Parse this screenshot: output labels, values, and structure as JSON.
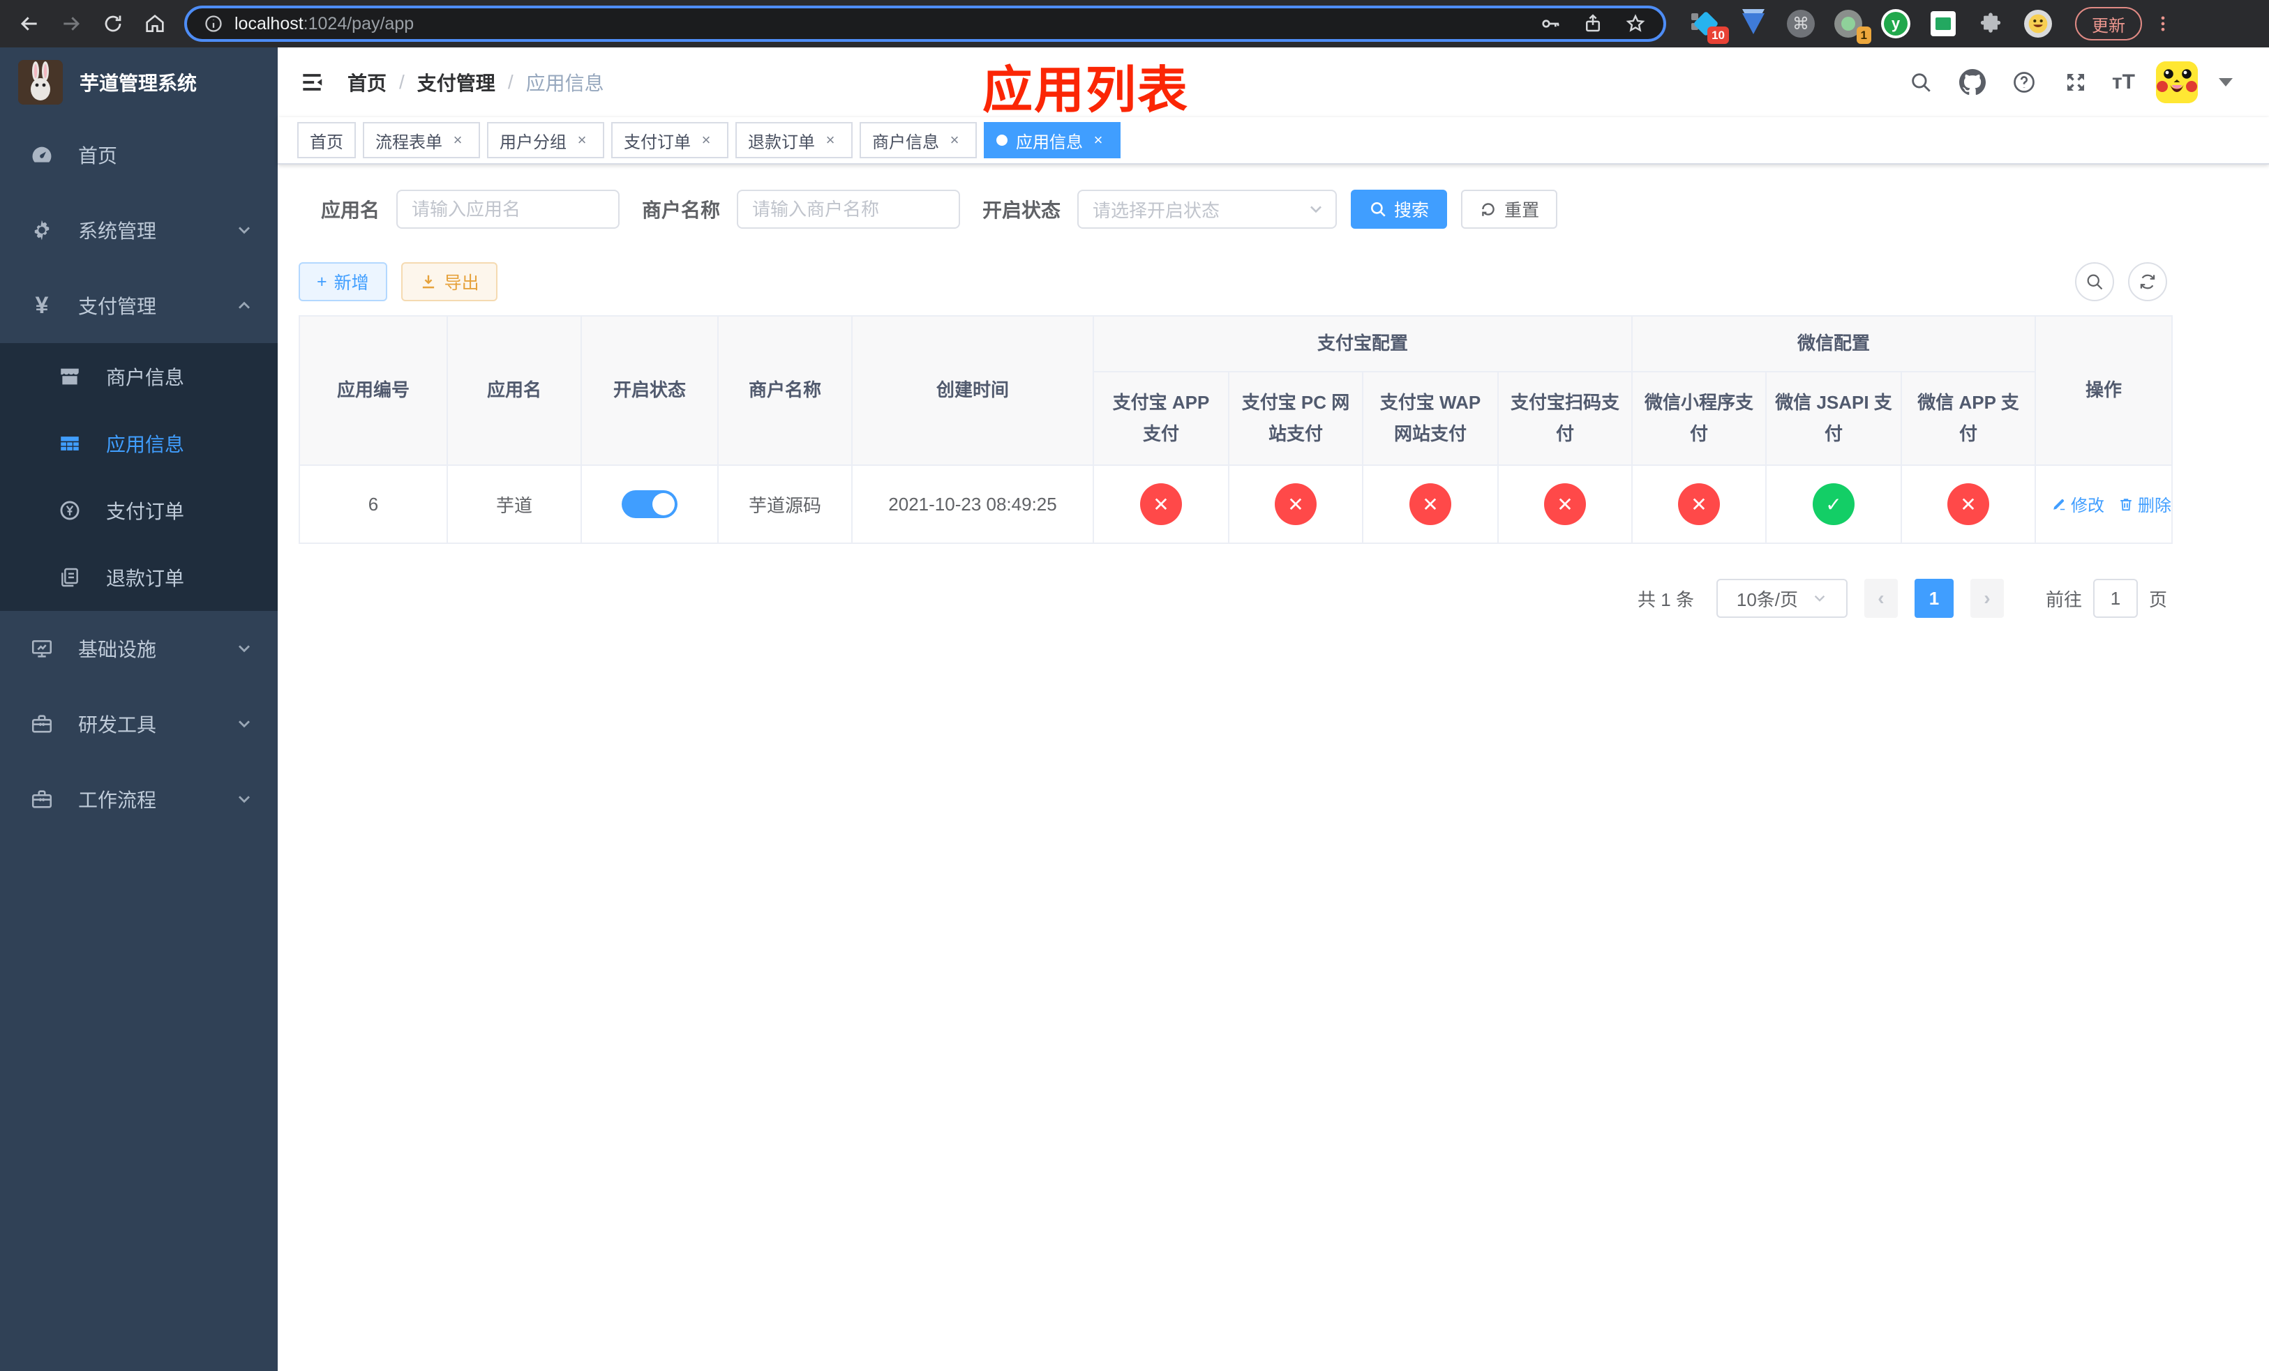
{
  "browser": {
    "url_primary": "localhost",
    "url_secondary": ":1024/pay/app",
    "update_label": "更新",
    "ext_badges": {
      "blue_diamond": "10",
      "session": "1"
    },
    "ext_y_letter": "y",
    "cmd_glyph": "⌘"
  },
  "sidebar": {
    "title": "芋道管理系统",
    "items": [
      {
        "label": "首页"
      },
      {
        "label": "系统管理"
      },
      {
        "label": "支付管理"
      },
      {
        "label": "商户信息"
      },
      {
        "label": "应用信息"
      },
      {
        "label": "支付订单"
      },
      {
        "label": "退款订单"
      },
      {
        "label": "基础设施"
      },
      {
        "label": "研发工具"
      },
      {
        "label": "工作流程"
      }
    ],
    "yen_glyph": "¥"
  },
  "header": {
    "breadcrumb": [
      "首页",
      "支付管理",
      "应用信息"
    ],
    "separator": "/",
    "annotation": "应用列表",
    "font_size_icon": "тT"
  },
  "tags": [
    {
      "label": "首页"
    },
    {
      "label": "流程表单"
    },
    {
      "label": "用户分组"
    },
    {
      "label": "支付订单"
    },
    {
      "label": "退款订单"
    },
    {
      "label": "商户信息"
    },
    {
      "label": "应用信息"
    }
  ],
  "filters": {
    "app_name_label": "应用名",
    "app_name_placeholder": "请输入应用名",
    "merchant_label": "商户名称",
    "merchant_placeholder": "请输入商户名称",
    "status_label": "开启状态",
    "status_placeholder": "请选择开启状态",
    "search_label": "搜索",
    "reset_label": "重置"
  },
  "actions": {
    "add": "新增",
    "export": "导出",
    "plus_glyph": "+"
  },
  "table": {
    "groups": {
      "alipay": "支付宝配置",
      "wechat": "微信配置"
    },
    "columns": {
      "id": "应用编号",
      "name": "应用名",
      "status": "开启状态",
      "merchant": "商户名称",
      "created": "创建时间",
      "alipay_app": "支付宝 APP 支付",
      "alipay_pc": "支付宝 PC 网站支付",
      "alipay_wap": "支付宝 WAP 网站支付",
      "alipay_qr": "支付宝扫码支付",
      "wx_mini": "微信小程序支付",
      "wx_jsapi": "微信 JSAPI 支付",
      "wx_app": "微信 APP 支付",
      "ops": "操作"
    },
    "row": {
      "id": "6",
      "name": "芋道",
      "enabled": true,
      "merchant": "芋道源码",
      "created": "2021-10-23 08:49:25",
      "alipay_app": "no",
      "alipay_pc": "no",
      "alipay_wap": "no",
      "alipay_qr": "no",
      "wx_mini": "no",
      "wx_jsapi": "yes",
      "wx_app": "no",
      "edit_label": "修改",
      "delete_label": "删除"
    }
  },
  "pagination": {
    "total": "共 1 条",
    "page_size": "10条/页",
    "current": "1",
    "goto_label": "前往",
    "goto_value": "1",
    "unit": "页"
  },
  "icons": {
    "close": "×",
    "prev": "‹",
    "next": "›",
    "check": "✓",
    "cross": "✕",
    "question": "?"
  },
  "colors": {
    "accent": "#409eff",
    "success": "#13ce66",
    "danger": "#ff4949",
    "warning": "#e6a23c",
    "sidebar_bg": "#304156",
    "submenu_bg": "#1f2d3d",
    "annotation_red": "#fb2605",
    "url_focus_ring": "#4e8df6"
  }
}
